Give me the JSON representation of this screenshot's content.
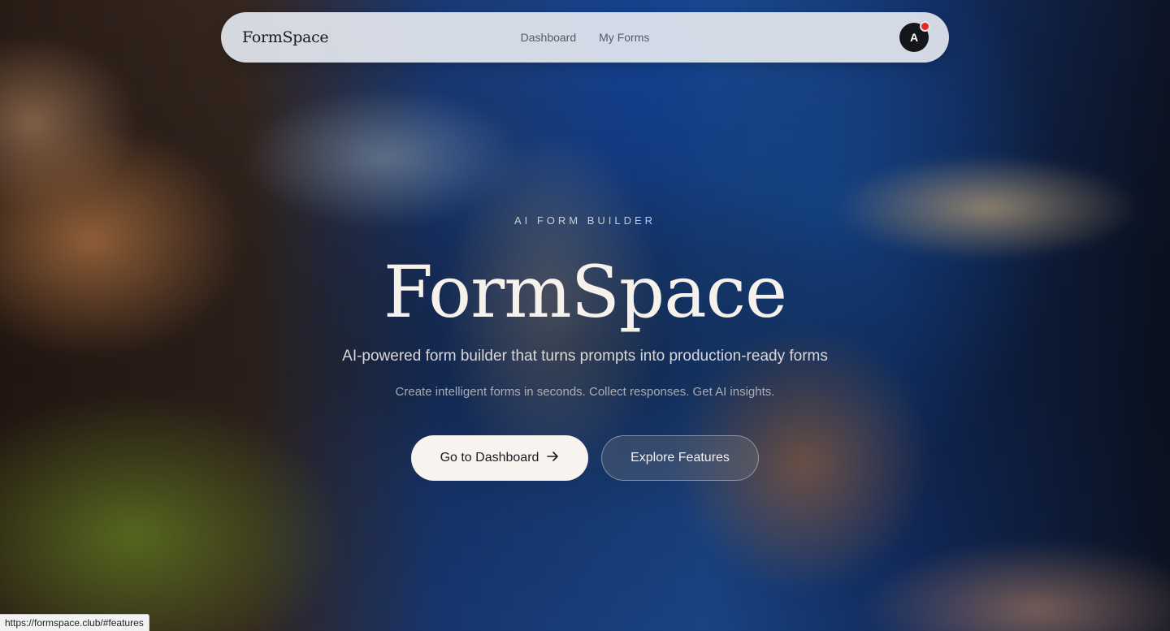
{
  "nav": {
    "brand": "FormSpace",
    "links": [
      "Dashboard",
      "My Forms"
    ],
    "avatar_initial": "A",
    "notification_color": "#e52a22"
  },
  "hero": {
    "eyebrow": "AI FORM BUILDER",
    "title": "FormSpace",
    "subtitle": "AI-powered form builder that turns prompts into production-ready forms",
    "tagline": "Create intelligent forms in seconds. Collect responses. Get AI insights.",
    "primary_button": "Go to Dashboard",
    "primary_button_icon": "arrow-right-icon",
    "secondary_button": "Explore Features"
  },
  "status_bar": {
    "url": "https://formspace.club/#features"
  },
  "colors": {
    "nav_background": "#e2e6ee",
    "title_text": "#f6f1ea",
    "primary_button_bg": "#f7f3ee"
  }
}
